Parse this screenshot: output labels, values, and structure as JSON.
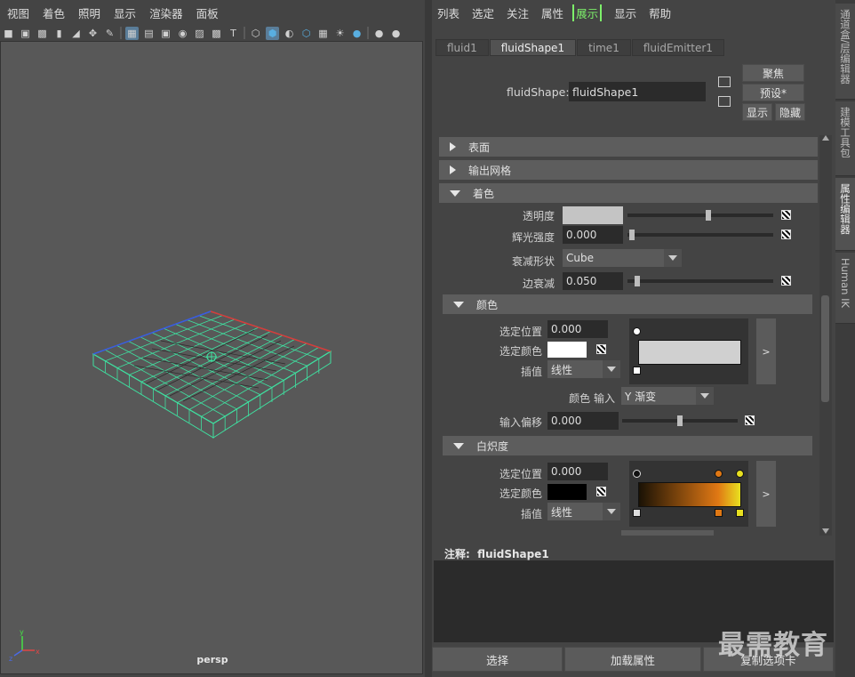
{
  "viewport": {
    "menu": [
      "视图",
      "着色",
      "照明",
      "显示",
      "渲染器",
      "面板"
    ],
    "camera_label": "persp",
    "axis_labels": {
      "x": "x",
      "y": "y",
      "z": "z"
    }
  },
  "toolbar_icons": [
    "camera-icon",
    "camera-lock-icon",
    "camera-attr-icon",
    "bookmark-icon",
    "image-plane-icon",
    "pan-zoom-icon",
    "grease-pencil-icon",
    "grid-icon",
    "film-gate-icon",
    "resolution-gate-icon",
    "gate-mask-icon",
    "field-chart-icon",
    "safe-action-icon",
    "safe-title-icon",
    "wireframe-icon",
    "smooth-shade-icon",
    "default-lighting-icon",
    "wireframe-on-shaded-icon",
    "xray-icon",
    "lights-icon",
    "shadows-icon",
    "ambient-occlusion-icon",
    "motion-blur-icon"
  ],
  "attribute_editor": {
    "menu": [
      "列表",
      "选定",
      "关注",
      "属性",
      "展示",
      "显示",
      "帮助"
    ],
    "menu_highlight": "展示",
    "tabs": [
      "fluid1",
      "fluidShape1",
      "time1",
      "fluidEmitter1"
    ],
    "active_tab": "fluidShape1",
    "node_type_label": "fluidShape:",
    "node_name": "fluidShape1",
    "buttons": {
      "focus": "聚焦",
      "presets": "预设*",
      "show": "显示",
      "hide": "隐藏"
    },
    "sections": {
      "surface": "表面",
      "output_mesh": "输出网格",
      "shading": "着色",
      "color": "颜色",
      "incandescence": "白炽度"
    },
    "shading": {
      "transparency_label": "透明度",
      "transparency_value": 0.56,
      "glow_label": "辉光强度",
      "glow_value": "0.000",
      "dropoff_shape_label": "衰减形状",
      "dropoff_shape_value": "Cube",
      "edge_dropoff_label": "边衰减",
      "edge_dropoff_value": "0.050"
    },
    "color": {
      "selected_position_label": "选定位置",
      "selected_position_value": "0.000",
      "selected_color_label": "选定颜色",
      "selected_color": "#ffffff",
      "interpolation_label": "插值",
      "interpolation_value": "线性",
      "color_input_label": "颜色 输入",
      "color_input_value": "Y 渐变",
      "input_bias_label": "输入偏移",
      "input_bias_value": "0.000",
      "ramp_color": "#d0d0d0",
      "expand_label": ">"
    },
    "incandescence": {
      "selected_position_label": "选定位置",
      "selected_position_value": "0.000",
      "selected_color_label": "选定颜色",
      "selected_color": "#000000",
      "interpolation_label": "插值",
      "interpolation_value": "线性",
      "expand_label": ">",
      "ramp_colors": [
        "#1a1205",
        "#e07814",
        "#e8e020"
      ]
    },
    "notes_label": "注释:",
    "notes_node": "fluidShape1",
    "bottom_buttons": [
      "选择",
      "加载属性",
      "复制选项卡"
    ]
  },
  "side_tabs": [
    "通道盒/层编辑器",
    "建模工具包",
    "属性编辑器",
    "Human IK"
  ],
  "active_side_tab": "属性编辑器",
  "watermark": "最需教育"
}
